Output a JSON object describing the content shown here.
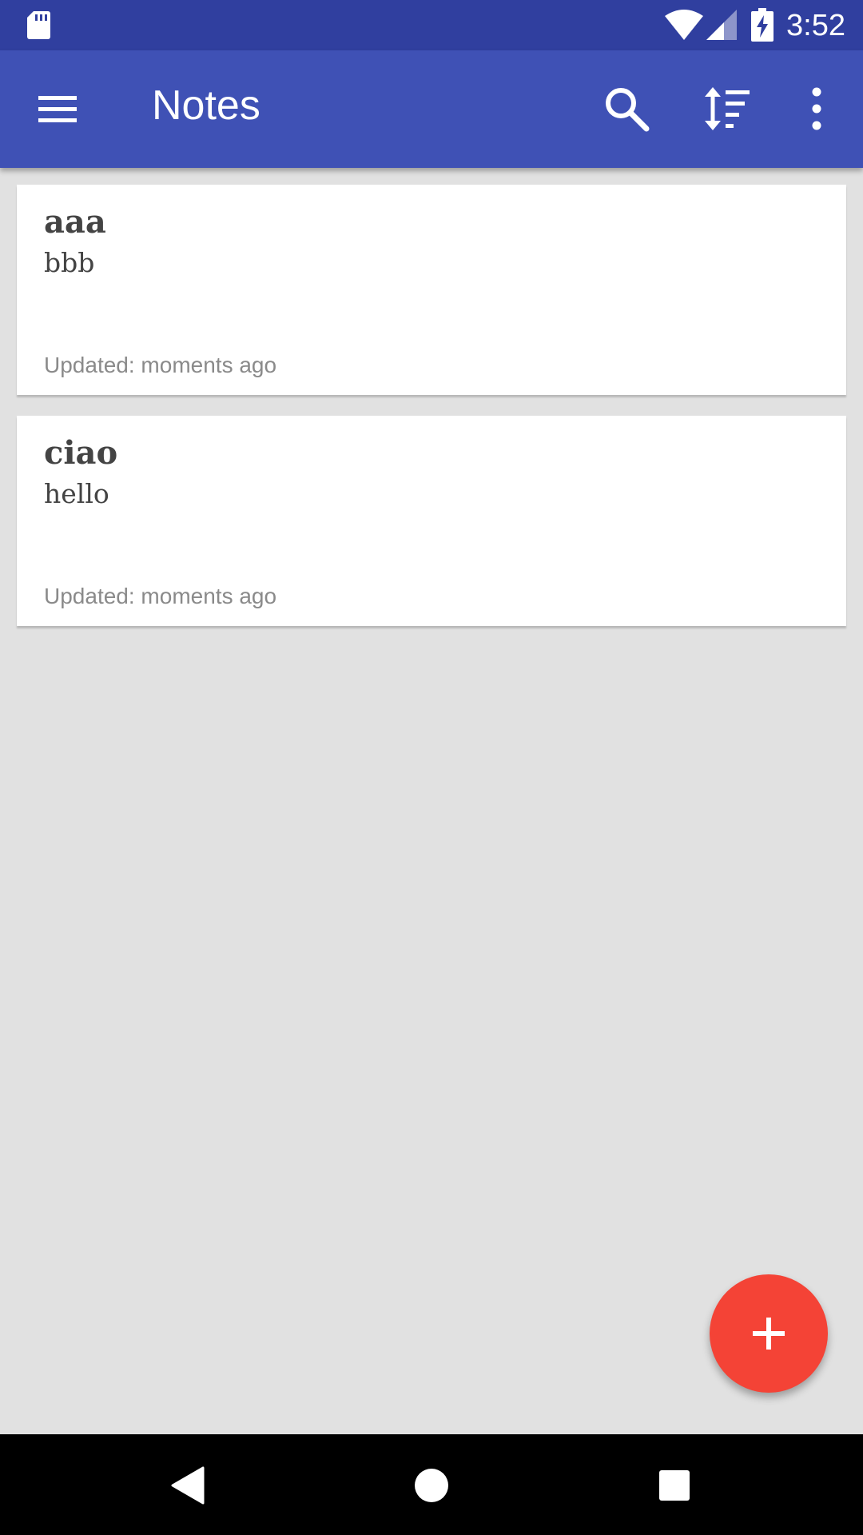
{
  "status_bar": {
    "time": "3:52",
    "icons": [
      "sd-card-icon",
      "wifi-icon",
      "cell-signal-icon",
      "battery-charging-icon"
    ]
  },
  "app_bar": {
    "title": "Notes",
    "icons": [
      "menu-icon",
      "search-icon",
      "sort-icon",
      "more-vert-icon"
    ]
  },
  "notes": [
    {
      "title": "aaa",
      "body": "bbb",
      "updated": "Updated: moments ago"
    },
    {
      "title": "ciao",
      "body": "hello",
      "updated": "Updated: moments ago"
    }
  ],
  "fab": {
    "icon": "plus-icon"
  },
  "nav_bar": {
    "icons": [
      "back-icon",
      "home-icon",
      "recents-icon"
    ]
  },
  "colors": {
    "status_bar": "#303f9f",
    "app_bar": "#3f51b5",
    "background": "#e1e1e1",
    "fab": "#f44336",
    "card": "#ffffff"
  }
}
